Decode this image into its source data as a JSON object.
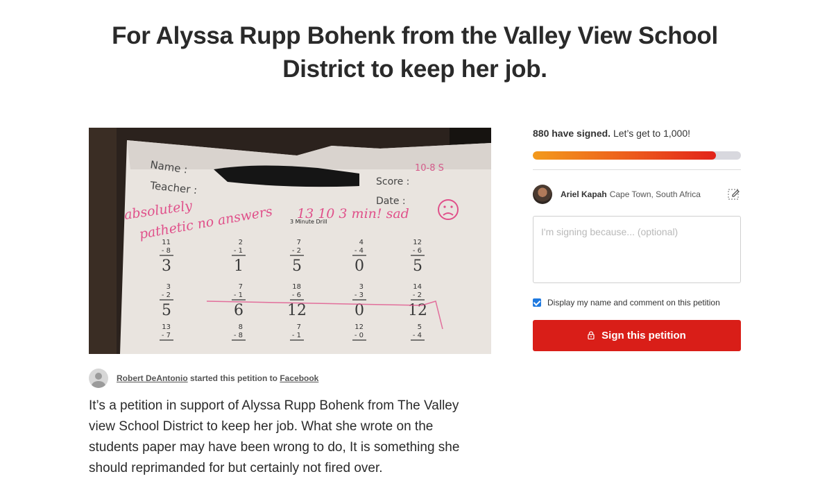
{
  "page": {
    "title": "For Alyssa Rupp Bohenk from the Valley View School District to keep her job."
  },
  "photo": {
    "worksheet": {
      "name_label": "Name :",
      "teacher_label": "Teacher :",
      "score_label": "Score :",
      "date_label": "Date :",
      "score_value": "10-8 S",
      "drill_label": "3 Minute Drill",
      "red_note_1": "absolutely",
      "red_note_2": "pathetic no answers",
      "red_note_3": "13 10 3 min! sad",
      "row1_tops": [
        "11",
        "2",
        "7",
        "4",
        "12"
      ],
      "row1_bottoms": [
        "8",
        "1",
        "2",
        "4",
        "6"
      ],
      "row1_answers": [
        "3",
        "1",
        "5",
        "0",
        "5"
      ],
      "row2_tops": [
        "3",
        "7",
        "18",
        "3",
        "14"
      ],
      "row2_bottoms": [
        "2",
        "1",
        "6",
        "3",
        "2"
      ],
      "row2_answers": [
        "5",
        "6",
        "12",
        "0",
        "12"
      ],
      "row3_tops": [
        "13",
        "8",
        "7",
        "12",
        "5"
      ],
      "row3_bottoms": [
        "7",
        "8",
        "1",
        "0",
        "4"
      ]
    }
  },
  "starter": {
    "name": "Robert DeAntonio",
    "middle": "started this petition to",
    "target": "Facebook"
  },
  "description": "It’s a  petition in support of Alyssa Rupp Bohenk from The Valley\nview School District to keep her job. What she wrote on the\n students paper may have been wrong to do, It is something she\nshould  reprimanded for but  certainly not fired over.",
  "sidebar": {
    "signed_count": "880 have signed.",
    "goal_text": "Let’s get to 1,000!",
    "progress_fraction": 0.88,
    "user": {
      "name": "Ariel Kapah",
      "location": "Cape Town, South Africa"
    },
    "comment_placeholder": "I'm signing because... (optional)",
    "checkbox_label": "Display my name and comment on this petition",
    "sign_button": "Sign this petition"
  },
  "colors": {
    "accent": "#d91e18",
    "progress_start": "#f39a1c",
    "progress_end": "#e2231a",
    "checkbox": "#1f7ae0"
  },
  "icons": [
    "edit-icon",
    "lock-icon",
    "avatar"
  ]
}
